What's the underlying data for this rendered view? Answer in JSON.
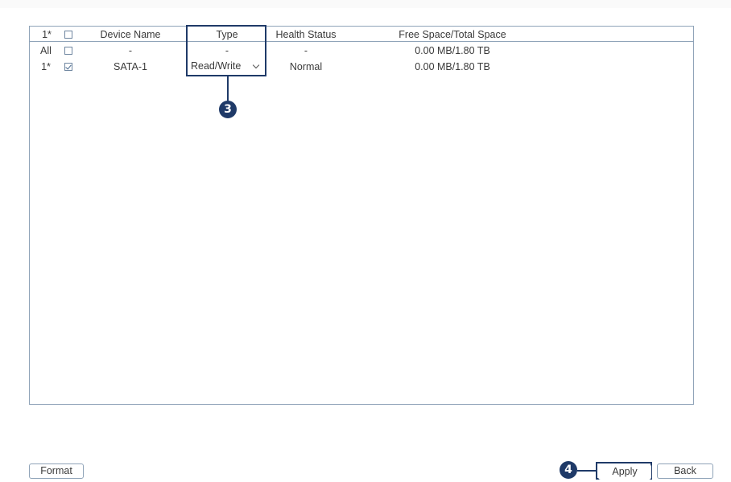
{
  "table": {
    "headers": {
      "index": "1*",
      "device_name": "Device Name",
      "type": "Type",
      "health_status": "Health Status",
      "space": "Free Space/Total Space"
    },
    "rows": [
      {
        "index": "All",
        "checked": false,
        "device_name": "-",
        "type": "-",
        "health_status": "-",
        "space": "0.00 MB/1.80 TB"
      },
      {
        "index": "1*",
        "checked": true,
        "device_name": "SATA-1",
        "type": "Read/Write",
        "health_status": "Normal",
        "space": "0.00 MB/1.80 TB"
      }
    ]
  },
  "callouts": {
    "type_step": "3",
    "apply_step": "4"
  },
  "buttons": {
    "format": "Format",
    "apply": "Apply",
    "back": "Back"
  },
  "colors": {
    "callout": "#1f3a68",
    "border": "#8fa3b8"
  }
}
